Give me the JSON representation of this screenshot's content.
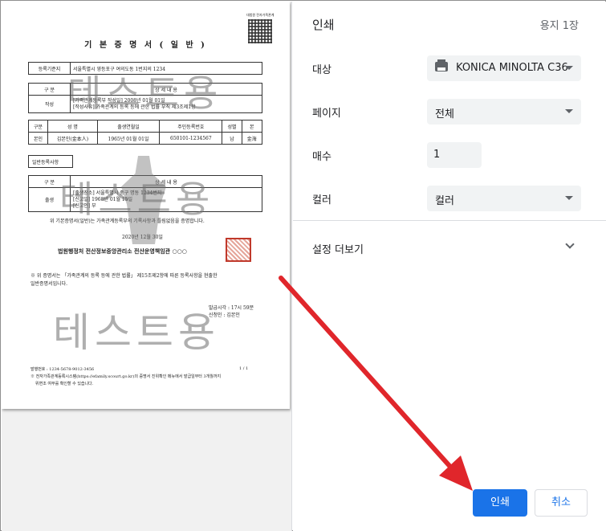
{
  "document": {
    "title": "기 본 증 명 서 ( 일 반 )",
    "qr_label": "대법원 전자가족관계",
    "registry_label": "등록기준지",
    "registry_value": "서울특별시 영등포구 여의도동 1번지의 1234",
    "section_header_a": "구  분",
    "detail_header_a": "상 세 내 용",
    "creation_label": "작성",
    "creation_line1": "[가족관계등록부 작성일] 2008년 01월 01일",
    "creation_line2": "[작성사유] 가족관계의 등록 등에 관한 법률 부칙 제3조제1항",
    "person_headers": [
      "구분",
      "성   명",
      "출생연월일",
      "주민등록번호",
      "성별",
      "본"
    ],
    "person_row": [
      "본인",
      "김본인(金本人)",
      "1965년 01월 01일",
      "650101-1234567",
      "남",
      "金海"
    ],
    "general_section": "일반등록사항",
    "section_header_b": "구  분",
    "detail_header_b": "상 세 내 용",
    "birth_label": "출생",
    "birth_line1": "[출생장소] 서울특별시 중구 명동 1234번지",
    "birth_line2": "[신고일] 1968년 01월 15일",
    "birth_line3": "[신고인] 부",
    "certify_text": "위 기본증명서(일반)는 가족관계등록부의 기록사항과 틀림없음을 증명합니다.",
    "issue_date": "2020년  12월  30일",
    "issuer": "법원행정처 전산정보중앙관리소 전산운영책임관 ○○○",
    "note_line1": "※ 위 증명서는 「가족관계의 등록 등에 관한 법률」 제15조제2항에 따른 등록사항을 현출한",
    "note_line2": "일반증명서입니다.",
    "issue_time": "발급시각 : 17시 59분",
    "applicant": "신청인 : 김본인",
    "serial": "발행번호 : 1234-5678-9012-3456",
    "page_num": "1  /  1",
    "footer_line1": "※ 전자가족관계등록시스템(https://efamily.scourt.go.kr)의 증명서 진위확인 메뉴에서 발급일부터 3개월까지",
    "footer_line2": "위변조 여부를 확인할 수 있습니다.",
    "watermark_text": "테스트용"
  },
  "settings": {
    "title": "인쇄",
    "page_count": "용지 1장",
    "destination_label": "대상",
    "destination_value": "KONICA MINOLTA C36",
    "pages_label": "페이지",
    "pages_value": "전체",
    "copies_label": "매수",
    "copies_value": "1",
    "color_label": "컬러",
    "color_value": "컬러",
    "more_settings_label": "설정 더보기",
    "print_button": "인쇄",
    "cancel_button": "취소"
  },
  "colors": {
    "accent": "#1a73e8",
    "arrow": "#e0262b",
    "field_bg": "#f1f3f4"
  },
  "icons": {
    "printer": "printer-icon",
    "dropdown": "chevron-down-icon"
  }
}
